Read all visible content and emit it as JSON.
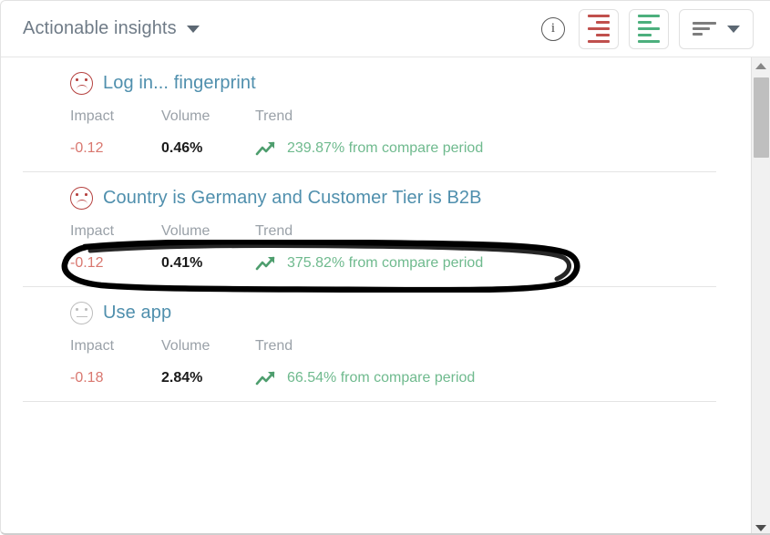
{
  "header": {
    "title": "Actionable insights",
    "title_caret_icon": "chevron-down-icon",
    "info_icon": "info-icon",
    "info_glyph": "i",
    "decrease_button_icon": "bars-right-aligned-icon",
    "increase_button_icon": "bars-left-aligned-icon",
    "sort_button_icon": "sort-icon",
    "sort_caret_icon": "chevron-down-icon"
  },
  "colors": {
    "title_text": "#6f7b87",
    "insight_link": "#4f8fad",
    "metric_label": "#9aa1a8",
    "impact_value": "#d9776f",
    "volume_value": "#1a1a1a",
    "trend_value": "#6fba8e",
    "negative_accent": "#c0504d",
    "positive_accent": "#4caf7d",
    "sad_face": "#b5413f",
    "neutral_face": "#bdbdbd",
    "divider": "#e4e4e4",
    "annotation": "#000000"
  },
  "metric_labels": {
    "impact": "Impact",
    "volume": "Volume",
    "trend": "Trend"
  },
  "insights": [
    {
      "title": "Log in... fingerprint",
      "sentiment": "sad",
      "sentiment_icon": "sad-face-icon",
      "impact": "-0.12",
      "volume": "0.46%",
      "trend": "239.87% from compare period",
      "trend_icon": "trending-up-icon",
      "annotated": false
    },
    {
      "title": "Country is Germany and Customer Tier is B2B",
      "sentiment": "sad",
      "sentiment_icon": "sad-face-icon",
      "impact": "-0.12",
      "volume": "0.41%",
      "trend": "375.82% from compare period",
      "trend_icon": "trending-up-icon",
      "annotated": true
    },
    {
      "title": "Use app",
      "sentiment": "neutral",
      "sentiment_icon": "neutral-face-icon",
      "impact": "-0.18",
      "volume": "2.84%",
      "trend": "66.54% from compare period",
      "trend_icon": "trending-up-icon",
      "annotated": false
    }
  ],
  "scrollbar": {
    "up_arrow_icon": "scroll-up-icon",
    "down_arrow_icon": "scroll-down-icon",
    "thumb": "scroll-thumb"
  }
}
